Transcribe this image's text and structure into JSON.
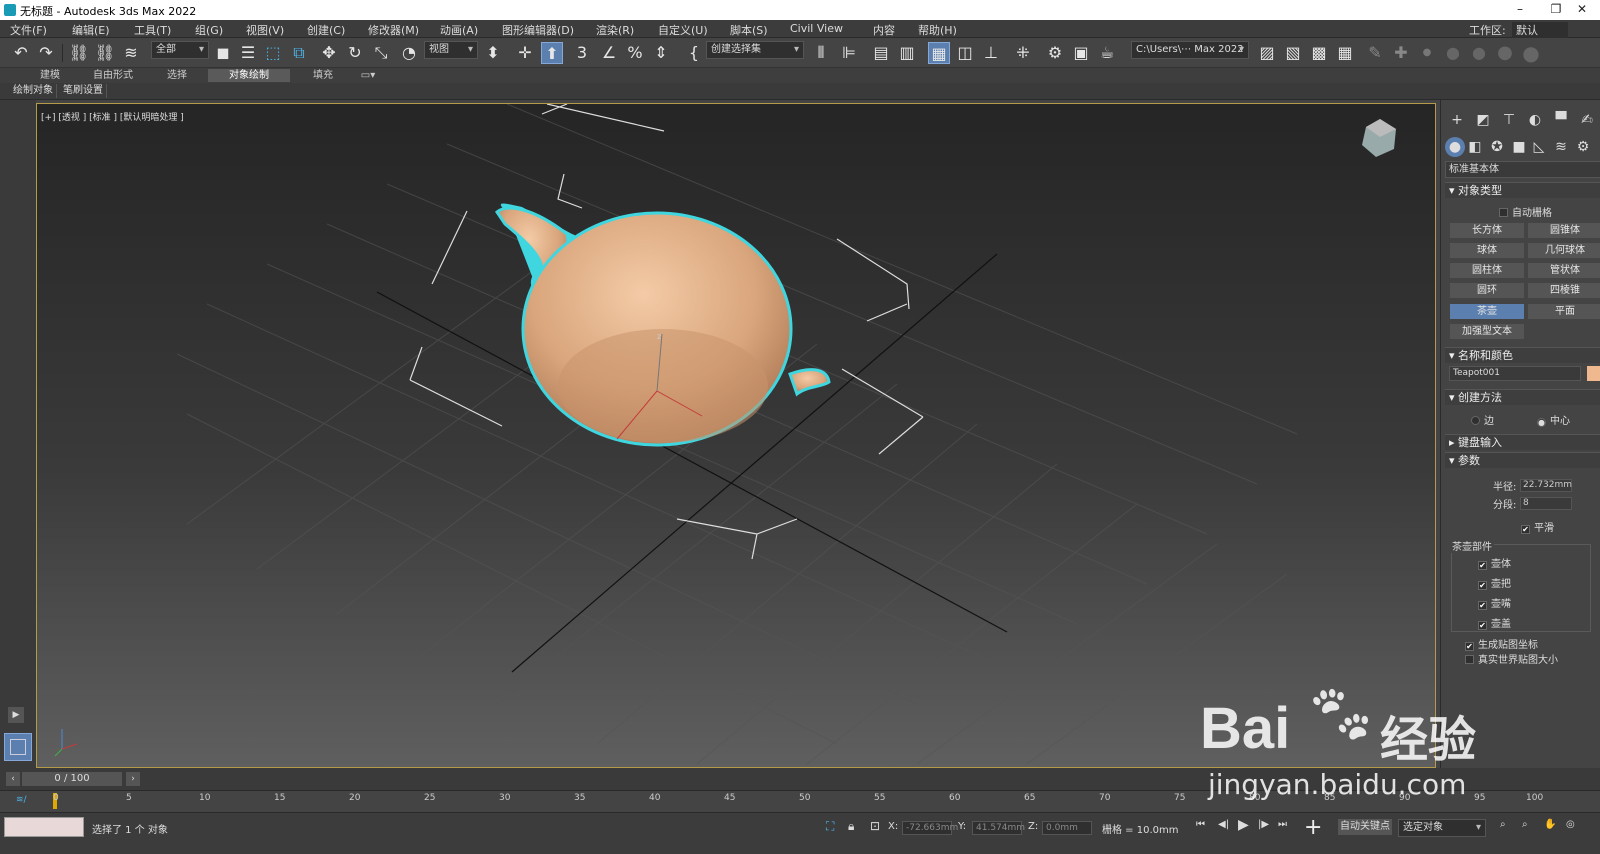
{
  "titlebar": {
    "title": "无标题 - Autodesk 3ds Max 2022",
    "minimize": "–",
    "restore": "❐",
    "close": "✕"
  },
  "menus": [
    "文件(F)",
    "编辑(E)",
    "工具(T)",
    "组(G)",
    "视图(V)",
    "创建(C)",
    "修改器(M)",
    "动画(A)",
    "图形编辑器(D)",
    "渲染(R)",
    "自定义(U)",
    "脚本(S)",
    "Civil View",
    "内容",
    "帮助(H)"
  ],
  "workspace": {
    "label": "工作区:",
    "value": "默认"
  },
  "toolbar": {
    "selection_filter": "全部",
    "ref_coord": "视图",
    "named_selection": "创建选择集",
    "project_path": "C:\\Users\\⋯ Max 2022"
  },
  "ribbon_tabs": [
    "建模",
    "自由形式",
    "选择",
    "对象绘制",
    "填充"
  ],
  "ribbon_row": [
    "绘制对象",
    "笔刷设置"
  ],
  "viewport": {
    "label": "[+] [透视 ] [标准 ] [默认明暗处理 ]",
    "axis_label": "z"
  },
  "panel": {
    "category": "标准基本体",
    "object_type": {
      "header": "对象类型",
      "autogrid": "自动栅格",
      "buttons": [
        "长方体",
        "圆锥体",
        "球体",
        "几何球体",
        "圆柱体",
        "管状体",
        "圆环",
        "四棱锥",
        "茶壶",
        "平面",
        "加强型文本"
      ]
    },
    "name_color": {
      "header": "名称和颜色",
      "name": "Teapot001",
      "color": "#f0b88f"
    },
    "creation_method": {
      "header": "创建方法",
      "edge": "边",
      "center": "中心"
    },
    "keyboard_entry": {
      "header": "键盘输入"
    },
    "params": {
      "header": "参数",
      "radius_label": "半径:",
      "radius": "22.732mm",
      "segments_label": "分段:",
      "segments": "8",
      "smooth": "平滑",
      "parts_title": "茶壶部件",
      "parts": [
        "壶体",
        "壶把",
        "壶嘴",
        "壶盖"
      ],
      "gen_uv": "生成贴图坐标",
      "real_world": "真实世界贴图大小"
    }
  },
  "timeline": {
    "frame": "0 / 100",
    "ticks": [
      "0",
      "5",
      "10",
      "15",
      "20",
      "25",
      "30",
      "35",
      "40",
      "45",
      "50",
      "55",
      "60",
      "65",
      "70",
      "75",
      "80",
      "85",
      "90",
      "95",
      "100"
    ]
  },
  "status": {
    "selected": "选择了 1 个 对象",
    "x_label": "X:",
    "x": "-72.663mm",
    "y_label": "Y:",
    "y": "41.574mm",
    "z_label": "Z:",
    "z": "0.0mm",
    "grid": "栅格 = 10.0mm",
    "autokey": "自动关键点",
    "set_key_mode": "选定对象"
  },
  "watermark": {
    "brand": "Bai",
    "brand2": "经验",
    "url": "jingyan.baidu.com"
  },
  "colors": {
    "accent": "#5b7fae",
    "teapot": "#e3b48e",
    "selection_outline": "#3fd6e0",
    "viewport_border": "#b49b4a"
  }
}
